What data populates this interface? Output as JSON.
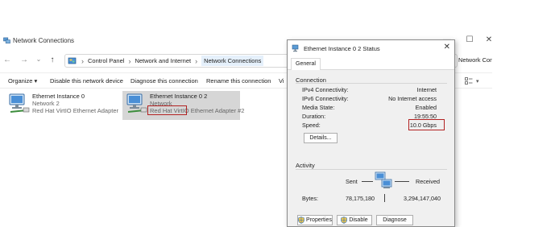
{
  "window": {
    "title": "Network Connections",
    "controls": {
      "minimize": "—",
      "maximize": "☐",
      "close": "✕"
    }
  },
  "nav": {
    "back": "←",
    "forward": "→",
    "recent": "⌄",
    "up": "↑"
  },
  "breadcrumb": {
    "separator": "›",
    "items": [
      "Control Panel",
      "Network and Internet",
      "Network Connections"
    ],
    "overflow_text": "Network Connecti"
  },
  "commands": {
    "organize": "Organize ▾",
    "disable": "Disable this network device",
    "diagnose": "Diagnose this connection",
    "rename": "Rename this connection",
    "view_partial": "Vi",
    "view_options_icon": "view-options-icon"
  },
  "connections": [
    {
      "name": "Ethernet Instance 0",
      "network": "Network 2",
      "device": "Red Hat VirtIO Ethernet Adapter"
    },
    {
      "name": "Ethernet Instance 0 2",
      "network": "Network",
      "device_highlight": "Red Hat VirtIO",
      "device_rest": " Ethernet Adapter #2"
    }
  ],
  "dialog": {
    "title": "Ethernet Instance 0 2 Status",
    "close": "✕",
    "tab": "General",
    "connection": {
      "heading": "Connection",
      "rows": [
        {
          "label": "IPv4 Connectivity:",
          "value": "Internet"
        },
        {
          "label": "IPv6 Connectivity:",
          "value": "No Internet access"
        },
        {
          "label": "Media State:",
          "value": "Enabled"
        },
        {
          "label": "Duration:",
          "value": "19:55:50"
        },
        {
          "label": "Speed:",
          "value": "10.0 Gbps"
        }
      ],
      "details_button": "Details..."
    },
    "activity": {
      "heading": "Activity",
      "sent_label": "Sent",
      "received_label": "Received",
      "bytes_label": "Bytes:",
      "bytes_sent": "78,175,180",
      "bytes_received": "3,294,147,040"
    },
    "buttons": {
      "properties": "Properties",
      "disable": "Disable",
      "diagnose": "Diagnose"
    }
  },
  "colors": {
    "highlight_box": "#b22222",
    "selection": "#d6d6d6",
    "accent": "#1e73c8"
  }
}
